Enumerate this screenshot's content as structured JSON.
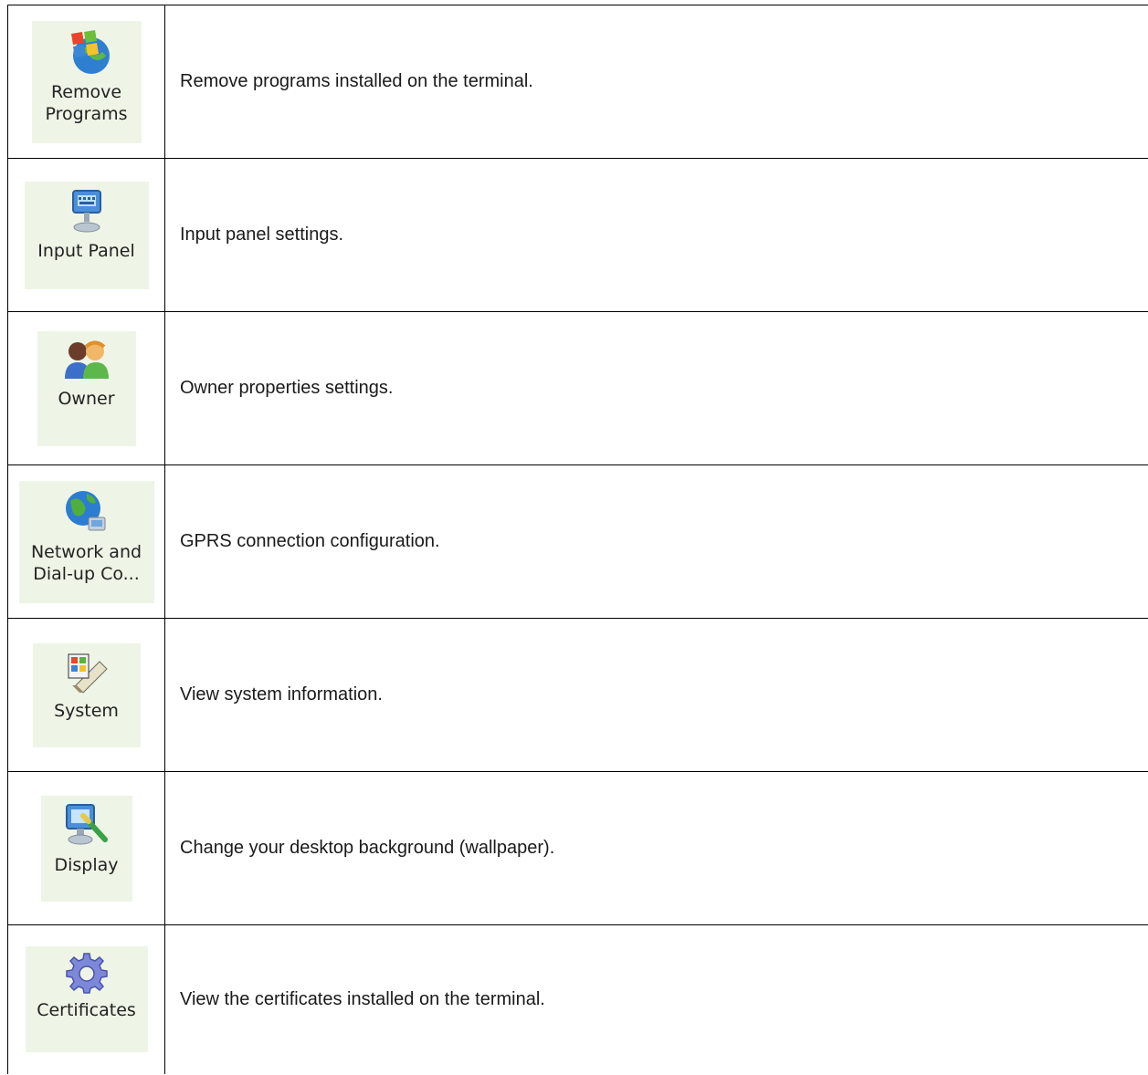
{
  "items": [
    {
      "label": "Remove\nPrograms",
      "icon": "windows-flag-globe-icon",
      "description": "Remove programs installed on the terminal."
    },
    {
      "label": "Input Panel",
      "icon": "keyboard-monitor-icon",
      "description": "Input panel settings."
    },
    {
      "label": "Owner",
      "icon": "users-icon",
      "description": "Owner properties settings."
    },
    {
      "label": "Network and\nDial-up Co...",
      "icon": "globe-network-icon",
      "description": "GPRS connection configuration."
    },
    {
      "label": "System",
      "icon": "system-windows-book-icon",
      "description": "View system information."
    },
    {
      "label": "Display",
      "icon": "monitor-paintbrush-icon",
      "description": "Change your desktop background (wallpaper)."
    },
    {
      "label": "Certificates",
      "icon": "gear-icon",
      "description": "View the certificates installed on the terminal."
    }
  ]
}
